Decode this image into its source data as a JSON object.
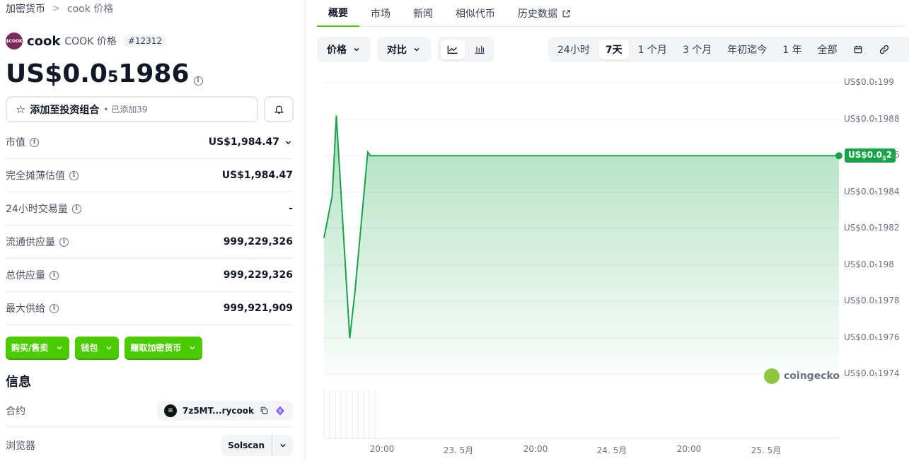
{
  "breadcrumb": {
    "first": "加密货币",
    "second": "cook 价格"
  },
  "coin": {
    "logo_text": "$COOK",
    "name": "cook",
    "symbol_label": "COOK 价格",
    "rank": "#12312"
  },
  "price": {
    "prefix": "US$0.0",
    "subscript": "5",
    "digits": "1986"
  },
  "portfolio": {
    "label": "添加至投资组合",
    "added": "已添加39"
  },
  "stats": [
    {
      "label": "市值",
      "value": "US$1,984.47"
    },
    {
      "label": "完全摊薄估值",
      "value": "US$1,984.47"
    },
    {
      "label": "24小时交易量",
      "value": "-"
    },
    {
      "label": "流通供应量",
      "value": "999,229,326"
    },
    {
      "label": "总供应量",
      "value": "999,229,326"
    },
    {
      "label": "最大供给",
      "value": "999,921,909"
    }
  ],
  "green_buttons": [
    "购买/售卖",
    "钱包",
    "赚取加密货币"
  ],
  "info": {
    "title": "信息",
    "contract_label": "合约",
    "contract_value": "7z5MT...rycook",
    "explorer_label": "浏览器",
    "explorer_value": "Solscan"
  },
  "tabs": [
    "概要",
    "市场",
    "新闻",
    "相似代币",
    "历史数据"
  ],
  "toolbar": {
    "price_btn": "价格",
    "compare_btn": "对比",
    "ranges": [
      "24小时",
      "7天",
      "1 个月",
      "3 个月",
      "年初迄今",
      "1 年",
      "全部"
    ],
    "selected_range": "7天"
  },
  "chart_data": {
    "type": "area",
    "y_ticks": [
      "US$0.0₅199",
      "US$0.0₅1988",
      "US$0.0₅1986",
      "US$0.0₅1984",
      "US$0.0₅1982",
      "US$0.0₅198",
      "US$0.0₅1978",
      "US$0.0₅1976",
      "US$0.0₅1974"
    ],
    "x_ticks": [
      "20:00",
      "23. 5月",
      "20:00",
      "24. 5月",
      "20:00",
      "25. 5月"
    ],
    "current_price_tag": {
      "prefix": "US$0.0",
      "subscript": "5",
      "digits": "2"
    },
    "watermark": "coingecko",
    "line_color": "#16a34a",
    "ylim": [
      1.974e-06,
      1.99e-06
    ],
    "series": [
      {
        "t": 0.0,
        "v": 1.9815e-06
      },
      {
        "t": 0.016,
        "v": 1.9838e-06
      },
      {
        "t": 0.024,
        "v": 1.9882e-06
      },
      {
        "t": 0.05,
        "v": 1.976e-06
      },
      {
        "t": 0.06,
        "v": 1.9785e-06
      },
      {
        "t": 0.085,
        "v": 1.9862e-06
      },
      {
        "t": 0.09,
        "v": 1.986e-06
      },
      {
        "t": 1.0,
        "v": 1.986e-06
      }
    ]
  }
}
